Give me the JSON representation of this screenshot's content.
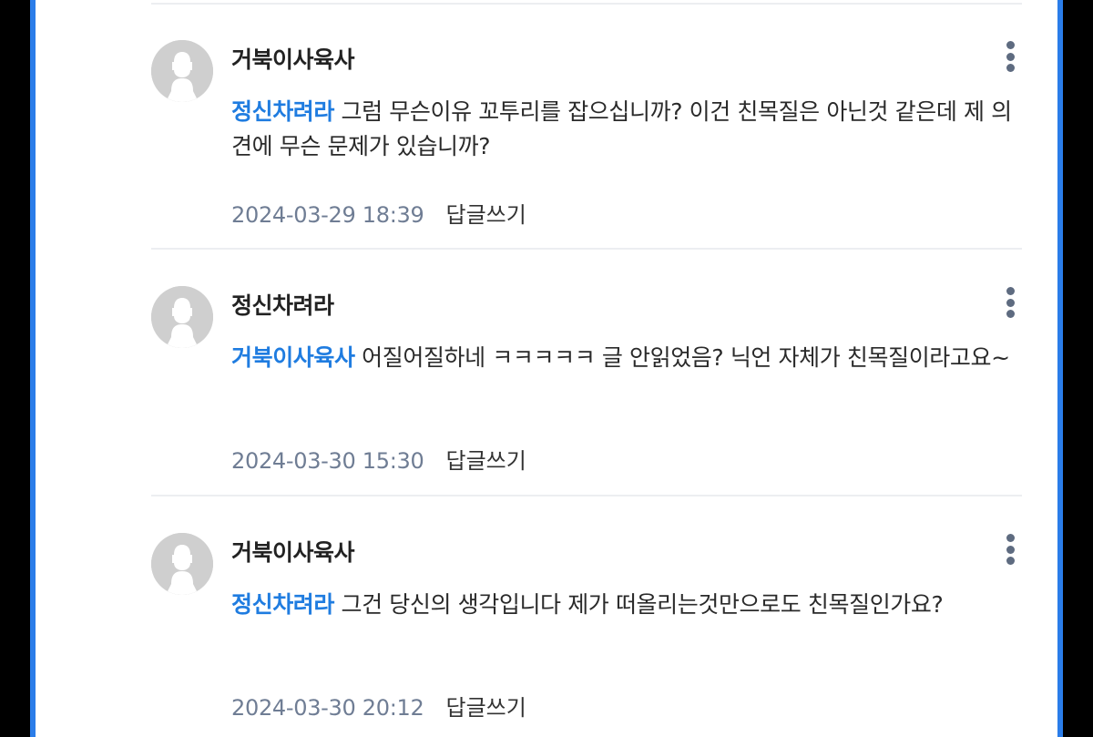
{
  "comments": [
    {
      "author": "거북이사육사",
      "mention": "정신차려라",
      "text": " 그럼 무슨이유 꼬투리를 잡으십니까? 이건 친목질은 아닌것 같은데 제 의견에 무슨 문제가 있습니까?",
      "date": "2024-03-29 18:39",
      "reply_label": "답글쓰기"
    },
    {
      "author": "정신차려라",
      "mention": "거북이사육사",
      "text": " 어질어질하네 ㅋㅋㅋㅋㅋ 글 안읽었음? 닉언 자체가 친목질이라고요~",
      "date": "2024-03-30 15:30",
      "reply_label": "답글쓰기"
    },
    {
      "author": "거북이사육사",
      "mention": "정신차려라",
      "text": " 그건 당신의 생각입니다 제가 떠올리는것만으로도 친목질인가요?",
      "date": "2024-03-30 20:12",
      "reply_label": "답글쓰기"
    }
  ],
  "colors": {
    "accent": "#2b7de9",
    "mention": "#1f7ce0",
    "date": "#6f7d94",
    "avatar_bg": "#cfcfcf",
    "more_icon": "#5e6b80"
  },
  "icons": {
    "avatar": "default-profile-icon",
    "more": "more-vertical-icon"
  }
}
